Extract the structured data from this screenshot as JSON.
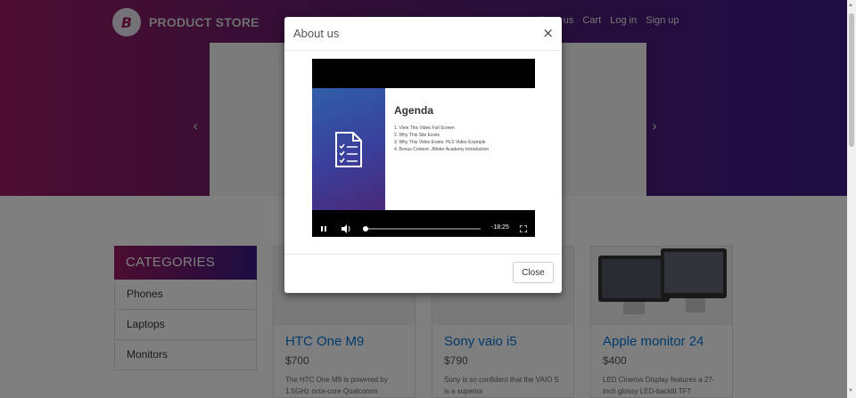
{
  "navbar": {
    "logo_letter": "B",
    "brand": "PRODUCT STORE",
    "links": [
      "About us",
      "Cart",
      "Log in",
      "Sign up"
    ]
  },
  "carousel": {
    "prev_arrow": "‹",
    "next_arrow": "›"
  },
  "categories": {
    "heading": "CATEGORIES",
    "items": [
      "Phones",
      "Laptops",
      "Monitors"
    ]
  },
  "products": [
    {
      "title": "HTC One M9",
      "price": "$700",
      "desc": "The HTC One M9 is powered by 1.5GHz octa-core Qualcomm"
    },
    {
      "title": "Sony vaio i5",
      "price": "$790",
      "desc": "Sony is so confident that the VAIO S is a superior"
    },
    {
      "title": "Apple monitor 24",
      "price": "$400",
      "desc": "LED Cinema Display features a 27-inch glossy LED-backlit TFT"
    }
  ],
  "modal": {
    "title": "About us",
    "close_x": "×",
    "close_button": "Close",
    "video": {
      "slide_title": "Agenda",
      "agenda": [
        "1.  View This Video Full Screen",
        "2.  Why This Site Exists",
        "3.  Why This Video Exists: HLS Video Example",
        "4.  Bonus Content: JMeter Academy Introduction"
      ],
      "time_remaining": "-18:25",
      "progress_fraction": 0.02,
      "icons": [
        "pause-icon",
        "volume-icon",
        "fullscreen-icon",
        "document-checklist-icon"
      ]
    }
  },
  "colors": {
    "hero_gradient": [
      "#9a1b62",
      "#3a1a84"
    ],
    "link_blue": "#0275d8"
  }
}
